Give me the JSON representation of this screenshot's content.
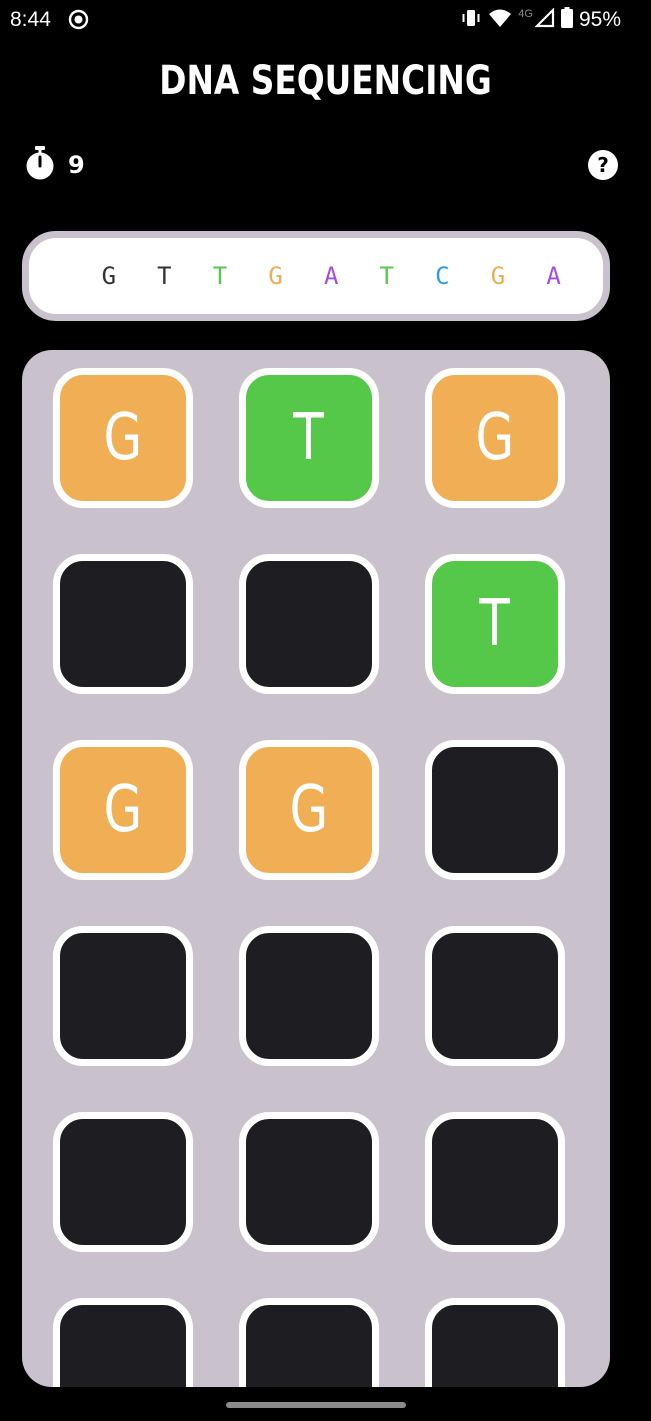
{
  "status_bar": {
    "time": "8:44",
    "network": "4G",
    "battery": "95%"
  },
  "header": {
    "title": "DNA SEQUENCING"
  },
  "timer": {
    "value": "9",
    "icon": "stopwatch-icon"
  },
  "help": {
    "label": "?",
    "icon": "help-icon"
  },
  "sequence": [
    {
      "letter": "G",
      "color": "#333333"
    },
    {
      "letter": "T",
      "color": "#333333"
    },
    {
      "letter": "T",
      "color": "#55c84a"
    },
    {
      "letter": "G",
      "color": "#efac55"
    },
    {
      "letter": "A",
      "color": "#a54be6"
    },
    {
      "letter": "T",
      "color": "#55c84a"
    },
    {
      "letter": "C",
      "color": "#2f9be8"
    },
    {
      "letter": "G",
      "color": "#efac55"
    },
    {
      "letter": "A",
      "color": "#a54be6"
    }
  ],
  "grid": {
    "columns": 3,
    "rows": [
      [
        {
          "letter": "G",
          "color": "#f0ae55"
        },
        {
          "letter": "T",
          "color": "#55c84a"
        },
        {
          "letter": "G",
          "color": "#f0ae55"
        }
      ],
      [
        {
          "letter": "",
          "color": "#1e1e22"
        },
        {
          "letter": "",
          "color": "#1e1e22"
        },
        {
          "letter": "T",
          "color": "#55c84a"
        }
      ],
      [
        {
          "letter": "G",
          "color": "#f0ae55"
        },
        {
          "letter": "G",
          "color": "#f0ae55"
        },
        {
          "letter": "",
          "color": "#1e1e22"
        }
      ],
      [
        {
          "letter": "",
          "color": "#1e1e22"
        },
        {
          "letter": "",
          "color": "#1e1e22"
        },
        {
          "letter": "",
          "color": "#1e1e22"
        }
      ],
      [
        {
          "letter": "",
          "color": "#1e1e22"
        },
        {
          "letter": "",
          "color": "#1e1e22"
        },
        {
          "letter": "",
          "color": "#1e1e22"
        }
      ],
      [
        {
          "letter": "",
          "color": "#1e1e22"
        },
        {
          "letter": "",
          "color": "#1e1e22"
        },
        {
          "letter": "",
          "color": "#1e1e22"
        }
      ]
    ]
  },
  "colors": {
    "board": "#c9c2cc",
    "tile_border": "#ffffff",
    "empty_tile": "#1e1e22"
  }
}
